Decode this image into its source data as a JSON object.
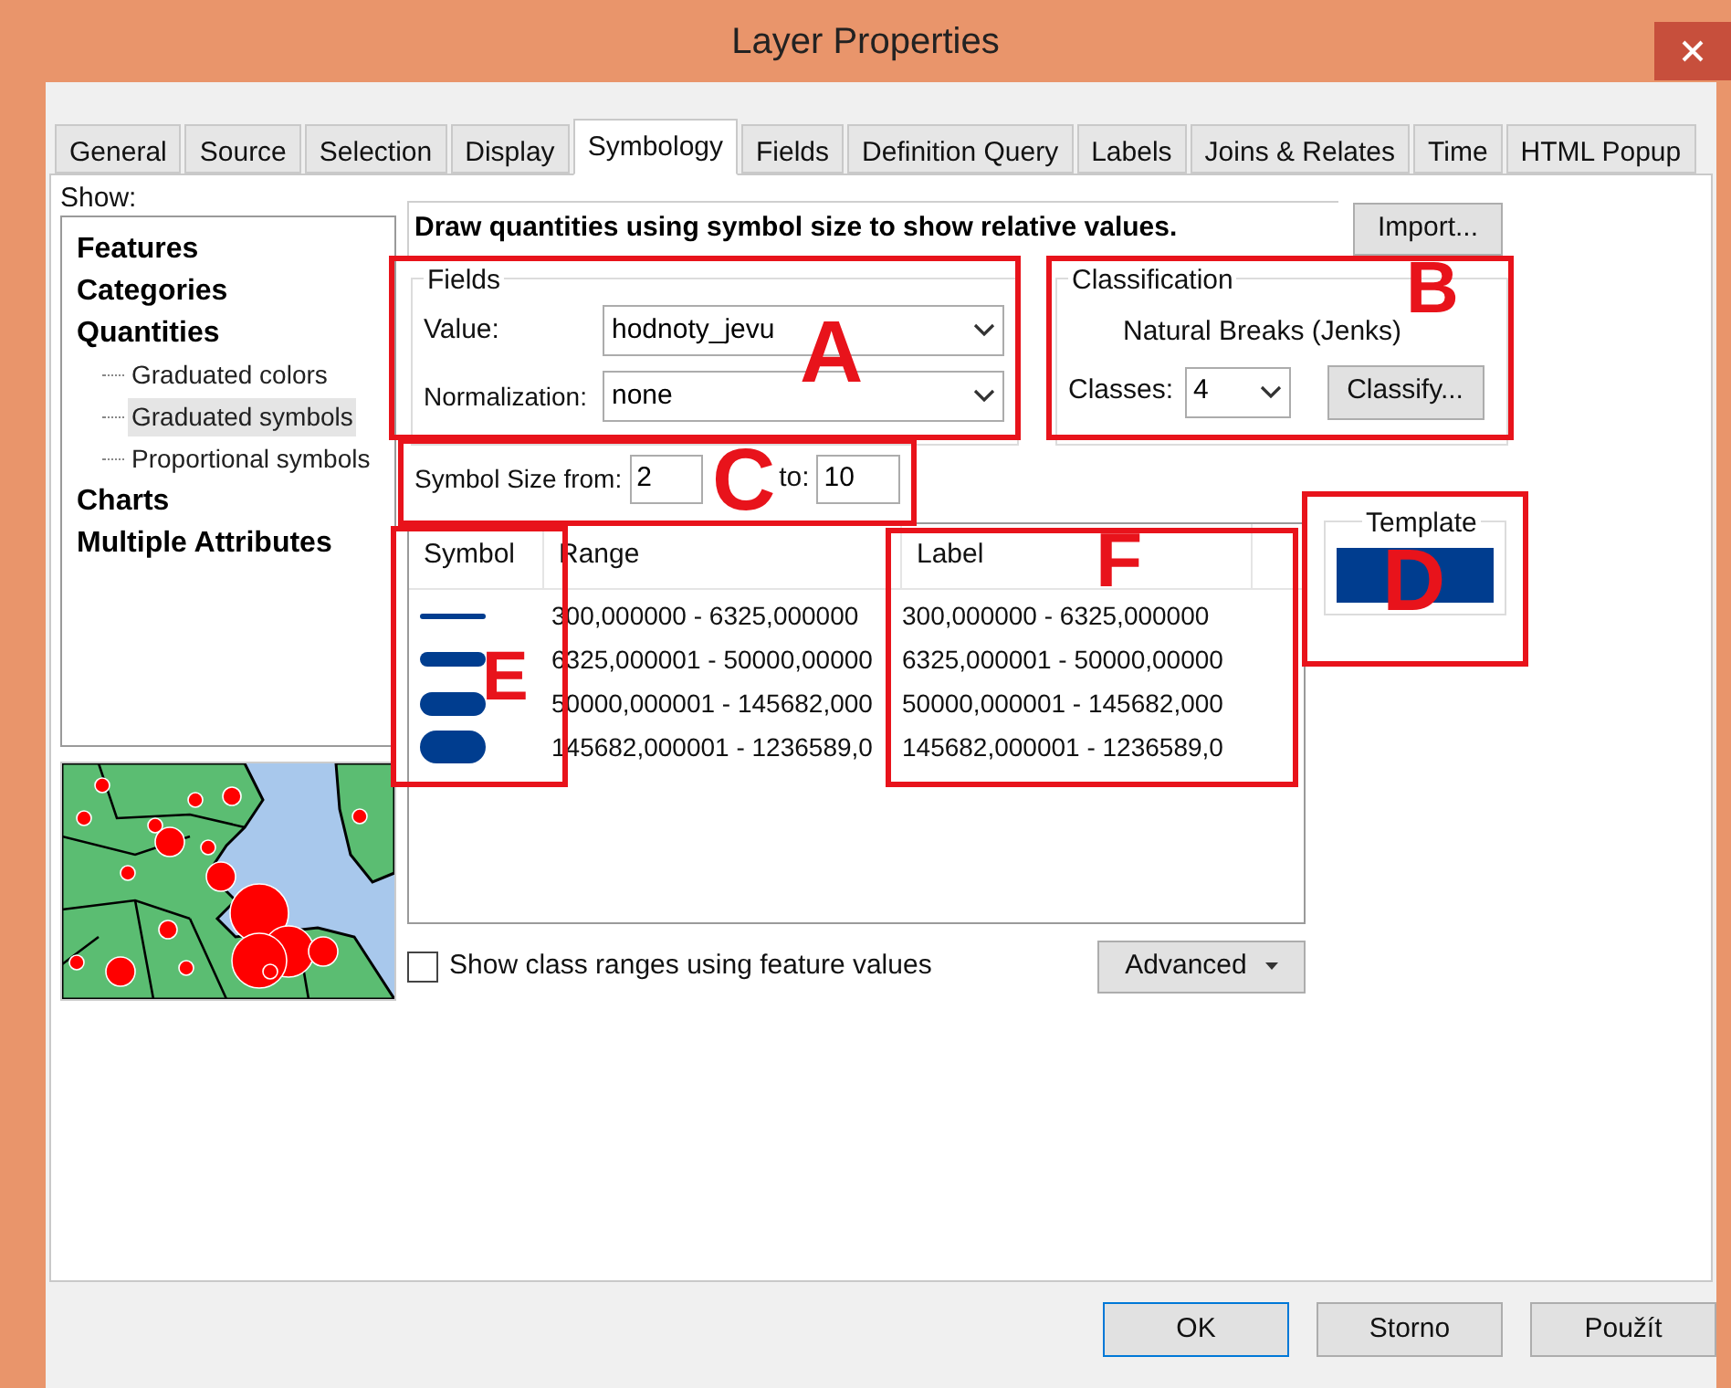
{
  "window": {
    "title": "Layer Properties"
  },
  "tabs": [
    {
      "label": "General",
      "selected": false
    },
    {
      "label": "Source",
      "selected": false
    },
    {
      "label": "Selection",
      "selected": false
    },
    {
      "label": "Display",
      "selected": false
    },
    {
      "label": "Symbology",
      "selected": true
    },
    {
      "label": "Fields",
      "selected": false
    },
    {
      "label": "Definition Query",
      "selected": false
    },
    {
      "label": "Labels",
      "selected": false
    },
    {
      "label": "Joins & Relates",
      "selected": false
    },
    {
      "label": "Time",
      "selected": false
    },
    {
      "label": "HTML Popup",
      "selected": false
    }
  ],
  "show_label": "Show:",
  "show_tree": [
    {
      "label": "Features",
      "selected": false
    },
    {
      "label": "Categories",
      "selected": false
    },
    {
      "label": "Quantities",
      "selected": false,
      "children": [
        {
          "label": "Graduated colors",
          "selected": false
        },
        {
          "label": "Graduated symbols",
          "selected": true
        },
        {
          "label": "Proportional symbols",
          "selected": false
        }
      ]
    },
    {
      "label": "Charts",
      "selected": false
    },
    {
      "label": "Multiple Attributes",
      "selected": false
    }
  ],
  "description": "Draw quantities using symbol size to show relative values.",
  "import_button": "Import...",
  "fields": {
    "title": "Fields",
    "value_label": "Value:",
    "value": "hodnoty_jevu",
    "normalization_label": "Normalization:",
    "normalization": "none"
  },
  "classification": {
    "title": "Classification",
    "method": "Natural Breaks (Jenks)",
    "classes_label": "Classes:",
    "classes": "4",
    "classify_button": "Classify..."
  },
  "symbol_size": {
    "from_label": "Symbol Size from:",
    "from": "2",
    "to_label": "to:",
    "to": "10"
  },
  "table": {
    "columns": [
      "Symbol",
      "Range",
      "Label"
    ],
    "rows": [
      {
        "range": "300,000000 - 6325,000000",
        "label": "300,000000 - 6325,000000"
      },
      {
        "range": "6325,000001 - 50000,00000",
        "label": "6325,000001 - 50000,00000"
      },
      {
        "range": "50000,000001 - 145682,000",
        "label": "50000,000001 - 145682,000"
      },
      {
        "range": "145682,000001 - 1236589,0",
        "label": "145682,000001 - 1236589,0"
      }
    ]
  },
  "template": {
    "title": "Template"
  },
  "show_class_ranges": {
    "label": "Show class ranges using feature values",
    "checked": false
  },
  "advanced_button": "Advanced",
  "annotations": [
    {
      "letter": "A"
    },
    {
      "letter": "B"
    },
    {
      "letter": "C"
    },
    {
      "letter": "D"
    },
    {
      "letter": "E"
    },
    {
      "letter": "F"
    }
  ],
  "dialog_buttons": [
    "OK",
    "Storno",
    "Použít"
  ]
}
